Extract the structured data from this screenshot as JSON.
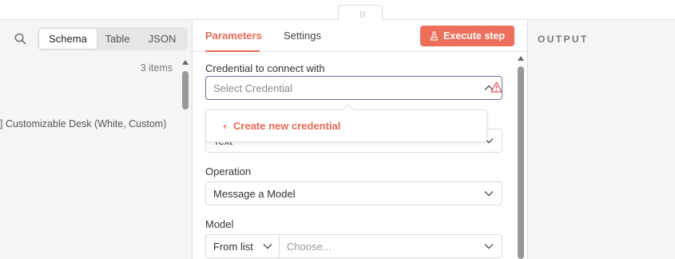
{
  "input": {
    "view_options": [
      "Schema",
      "Table",
      "JSON"
    ],
    "active_view": "Schema",
    "items_count": "3 items",
    "list_item": "] Customizable Desk (White, Custom)"
  },
  "params": {
    "tabs": [
      "Parameters",
      "Settings"
    ],
    "active_tab": "Parameters",
    "execute_label": "Execute step",
    "credential_label": "Credential to connect with",
    "credential_placeholder": "Select Credential",
    "create_credential": "Create new credential",
    "resource_value": "Text",
    "operation_label": "Operation",
    "operation_value": "Message a Model",
    "model_label": "Model",
    "model_mode": "From list",
    "model_placeholder": "Choose..."
  },
  "output": {
    "title": "OUTPUT"
  },
  "colors": {
    "accent": "#ea6a56",
    "focus_border": "#7466a8",
    "warning": "#e8505b"
  },
  "icons": [
    "search-icon",
    "flask-icon",
    "chevron-down-icon",
    "chevron-up-icon",
    "warning-icon",
    "plus-icon",
    "drag-handle-icon"
  ]
}
